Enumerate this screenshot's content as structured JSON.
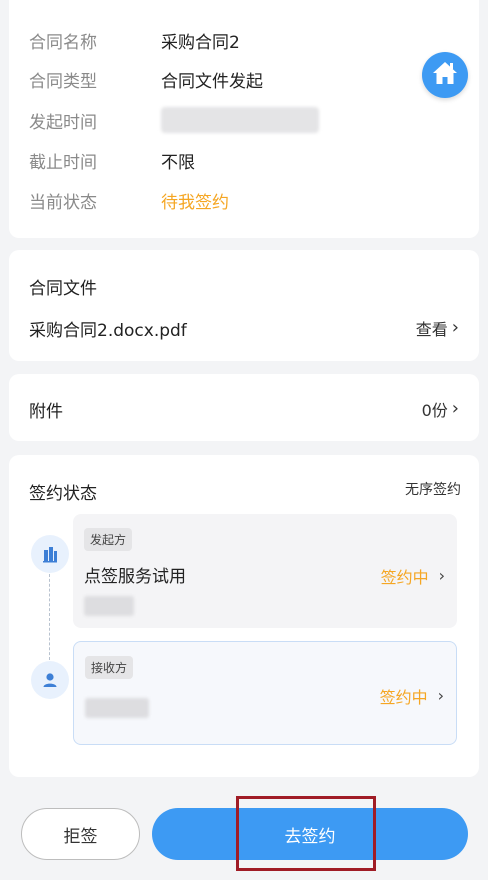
{
  "info": {
    "rows": [
      {
        "label": "合同名称",
        "value": "采购合同2"
      },
      {
        "label": "合同类型",
        "value": "合同文件发起"
      },
      {
        "label": "发起时间",
        "value": ""
      },
      {
        "label": "截止时间",
        "value": "不限"
      },
      {
        "label": "当前状态",
        "value": "待我签约"
      }
    ],
    "home_icon": "home-icon"
  },
  "contract_file": {
    "title": "合同文件",
    "file_name": "采购合同2.docx.pdf",
    "view_label": "查看"
  },
  "attachment": {
    "title": "附件",
    "count_label": "0份"
  },
  "signing": {
    "title": "签约状态",
    "order": "无序签约",
    "sender": {
      "role": "发起方",
      "name": "点签服务试用",
      "status": "签约中",
      "icon": "building-icon"
    },
    "receiver": {
      "role": "接收方",
      "status": "签约中",
      "icon": "user-icon"
    }
  },
  "actions": {
    "reject_label": "拒签",
    "sign_label": "去签约"
  },
  "colors": {
    "accent": "#3d9af3",
    "pending": "#f5a623",
    "highlight": "#a01c26"
  }
}
